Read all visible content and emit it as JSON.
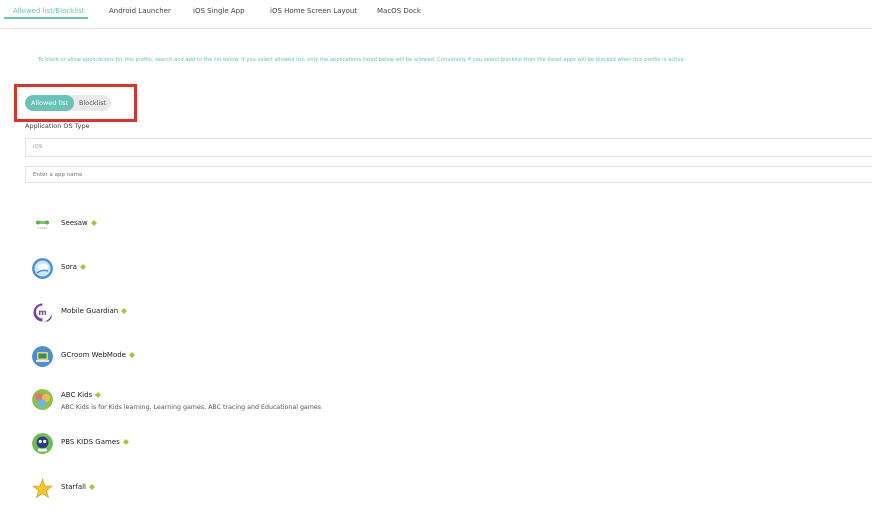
{
  "tabs": [
    {
      "label": "Allowed list/Blocklist",
      "active": true
    },
    {
      "label": "Android Launcher",
      "active": false
    },
    {
      "label": "iOS Single App",
      "active": false
    },
    {
      "label": "iOS Home Screen Layout",
      "active": false
    },
    {
      "label": "MacOS Dock",
      "active": false
    }
  ],
  "info_text": "To block or allow applications for this profile, search and add to the list below. If you select allowed list, only the applications listed below will be allowed. Conversely if you select blocklist then the listed apps will be blocked when this profile is active.",
  "mode_toggle": {
    "options": [
      "Allowed list",
      "Blocklist"
    ],
    "selected": "Allowed list"
  },
  "os_type": {
    "label": "Application OS Type",
    "value": "iOS"
  },
  "app_search": {
    "placeholder": "Enter a app name"
  },
  "apps": [
    {
      "name": "Seesaw",
      "description": "",
      "platform_icon": "android-icon"
    },
    {
      "name": "Sora",
      "description": "",
      "platform_icon": "android-icon"
    },
    {
      "name": "Mobile Guardian",
      "description": "",
      "platform_icon": "android-icon"
    },
    {
      "name": "GCroom WebMode",
      "description": "",
      "platform_icon": "android-icon"
    },
    {
      "name": "ABC Kids",
      "description": "ABC Kids is for Kids learning, Learning games, ABC tracing and Educational games",
      "platform_icon": "android-icon"
    },
    {
      "name": "PBS KIDS Games",
      "description": "",
      "platform_icon": "android-icon"
    },
    {
      "name": "Starfall",
      "description": "",
      "platform_icon": "android-icon"
    }
  ],
  "colors": {
    "accent": "#6bc3b8",
    "highlight_border": "#d9342b",
    "android_green": "#a4c639"
  }
}
